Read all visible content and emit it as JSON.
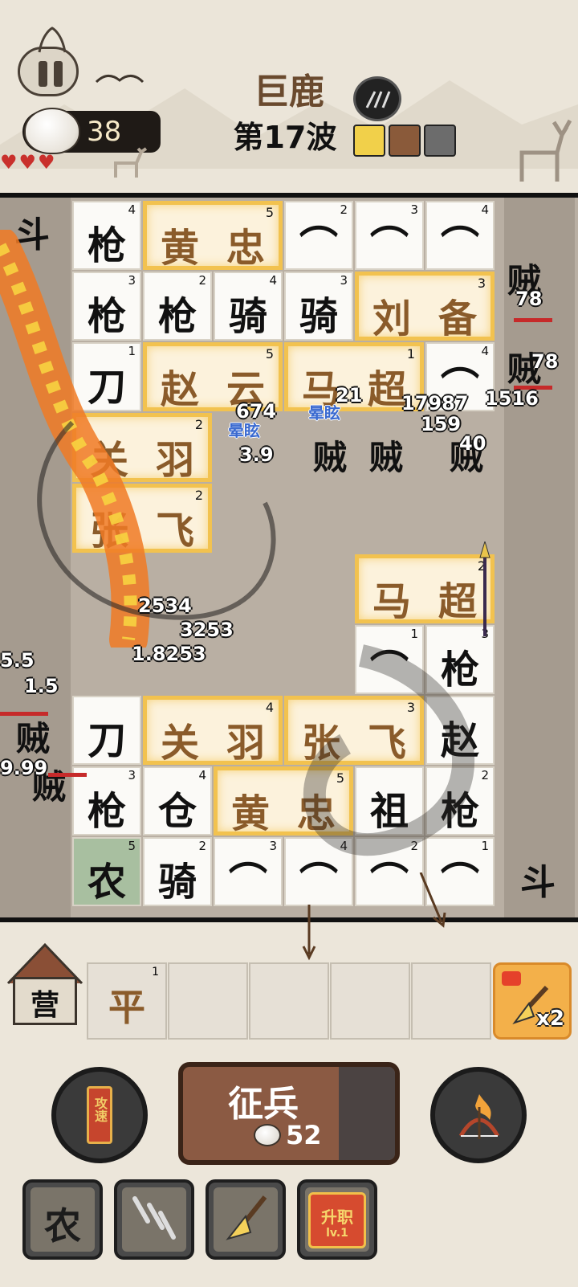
{
  "hud": {
    "enemy_name": "巨鹿",
    "wave_label": "第17波",
    "rice_count": "38",
    "buffs": [
      "shovel-buff-icon",
      "stomach-buff-icon",
      "claw-buff-icon"
    ]
  },
  "battlefield": {
    "left_gate": "斗",
    "right_gate": "斗",
    "tiles": [
      {
        "glyph": "枪",
        "lvl": "4",
        "col": 1,
        "row": 0
      },
      {
        "glyph": "⌒",
        "lvl": "2",
        "col": 4,
        "row": 0
      },
      {
        "glyph": "⌒",
        "lvl": "3",
        "col": 5,
        "row": 0
      },
      {
        "glyph": "⌒",
        "lvl": "4",
        "col": 6,
        "row": 0
      },
      {
        "glyph": "枪",
        "lvl": "3",
        "col": 1,
        "row": 1
      },
      {
        "glyph": "枪",
        "lvl": "2",
        "col": 2,
        "row": 1
      },
      {
        "glyph": "骑",
        "lvl": "4",
        "col": 3,
        "row": 1
      },
      {
        "glyph": "骑",
        "lvl": "3",
        "col": 4,
        "row": 1
      },
      {
        "glyph": "刀",
        "lvl": "1",
        "col": 1,
        "row": 2
      },
      {
        "glyph": "⌒",
        "lvl": "4",
        "col": 6,
        "row": 2
      },
      {
        "glyph": "⌒",
        "lvl": "1",
        "col": 5,
        "row": 6
      },
      {
        "glyph": "枪",
        "lvl": "3",
        "col": 6,
        "row": 6
      },
      {
        "glyph": "刀",
        "lvl": "",
        "col": 1,
        "row": 7
      },
      {
        "glyph": "赵",
        "lvl": "",
        "col": 6,
        "row": 7
      },
      {
        "glyph": "枪",
        "lvl": "3",
        "col": 1,
        "row": 8
      },
      {
        "glyph": "仓",
        "lvl": "4",
        "col": 2,
        "row": 8
      },
      {
        "glyph": "祖",
        "lvl": "",
        "col": 5,
        "row": 8
      },
      {
        "glyph": "枪",
        "lvl": "2",
        "col": 6,
        "row": 8
      },
      {
        "glyph": "农",
        "lvl": "5",
        "col": 1,
        "row": 9,
        "farm": true
      },
      {
        "glyph": "骑",
        "lvl": "2",
        "col": 2,
        "row": 9
      },
      {
        "glyph": "⌒",
        "lvl": "3",
        "col": 3,
        "row": 9
      },
      {
        "glyph": "⌒",
        "lvl": "4",
        "col": 4,
        "row": 9
      },
      {
        "glyph": "⌒",
        "lvl": "2",
        "col": 5,
        "row": 9
      },
      {
        "glyph": "⌒",
        "lvl": "1",
        "col": 6,
        "row": 9
      }
    ],
    "heroes": [
      {
        "name": [
          "黄",
          "忠"
        ],
        "lvl": "5",
        "col": 2,
        "row": 0,
        "span": 2
      },
      {
        "name": [
          "刘",
          "备"
        ],
        "lvl": "3",
        "col": 5,
        "row": 1,
        "span": 2
      },
      {
        "name": [
          "赵",
          "云"
        ],
        "lvl": "5",
        "col": 2,
        "row": 2,
        "span": 2
      },
      {
        "name": [
          "马",
          "超"
        ],
        "lvl": "1",
        "col": 4,
        "row": 2,
        "span": 2
      },
      {
        "name": [
          "关",
          "羽"
        ],
        "lvl": "2",
        "col": 1,
        "row": 3,
        "span": 2
      },
      {
        "name": [
          "张",
          "飞"
        ],
        "lvl": "2",
        "col": 1,
        "row": 4,
        "span": 2
      },
      {
        "name": [
          "马",
          "超"
        ],
        "lvl": "2",
        "col": 5,
        "row": 5,
        "span": 2
      },
      {
        "name": [
          "关",
          "羽"
        ],
        "lvl": "4",
        "col": 2,
        "row": 7,
        "span": 2
      },
      {
        "name": [
          "张",
          "飞"
        ],
        "lvl": "3",
        "col": 4,
        "row": 7,
        "span": 2
      },
      {
        "name": [
          "黄",
          "忠"
        ],
        "lvl": "5",
        "col": 3,
        "row": 8,
        "span": 2
      }
    ],
    "bandit_glyph": "贼",
    "enemy_hp": [
      "78",
      "78"
    ],
    "damage_numbers": [
      "674",
      "3.9",
      "21",
      "17987",
      "1516",
      "159",
      "40",
      "2534",
      "3253",
      "1.8253",
      "5.5",
      "1.5",
      "9.99"
    ],
    "status_text": [
      "晕眩",
      "晕眩"
    ]
  },
  "bench": {
    "camp_label": "营",
    "slots": [
      {
        "glyph": "平",
        "lvl": "1"
      },
      {
        "glyph": "",
        "lvl": ""
      },
      {
        "glyph": "",
        "lvl": ""
      },
      {
        "glyph": "",
        "lvl": ""
      },
      {
        "glyph": "",
        "lvl": ""
      }
    ],
    "shovel_multiplier": "x2"
  },
  "actions": {
    "attack_order_label": "攻速",
    "recruit_label": "征兵",
    "recruit_cost": "52"
  },
  "skills": {
    "farm_label": "农",
    "promote_label": "升职",
    "promote_level": "lv.1"
  },
  "colors": {
    "hero_border": "#f2c24f",
    "hero_text": "#8a5b2a",
    "hp_bar": "#c62a2a",
    "recruit_bg": "#8b5a43"
  }
}
